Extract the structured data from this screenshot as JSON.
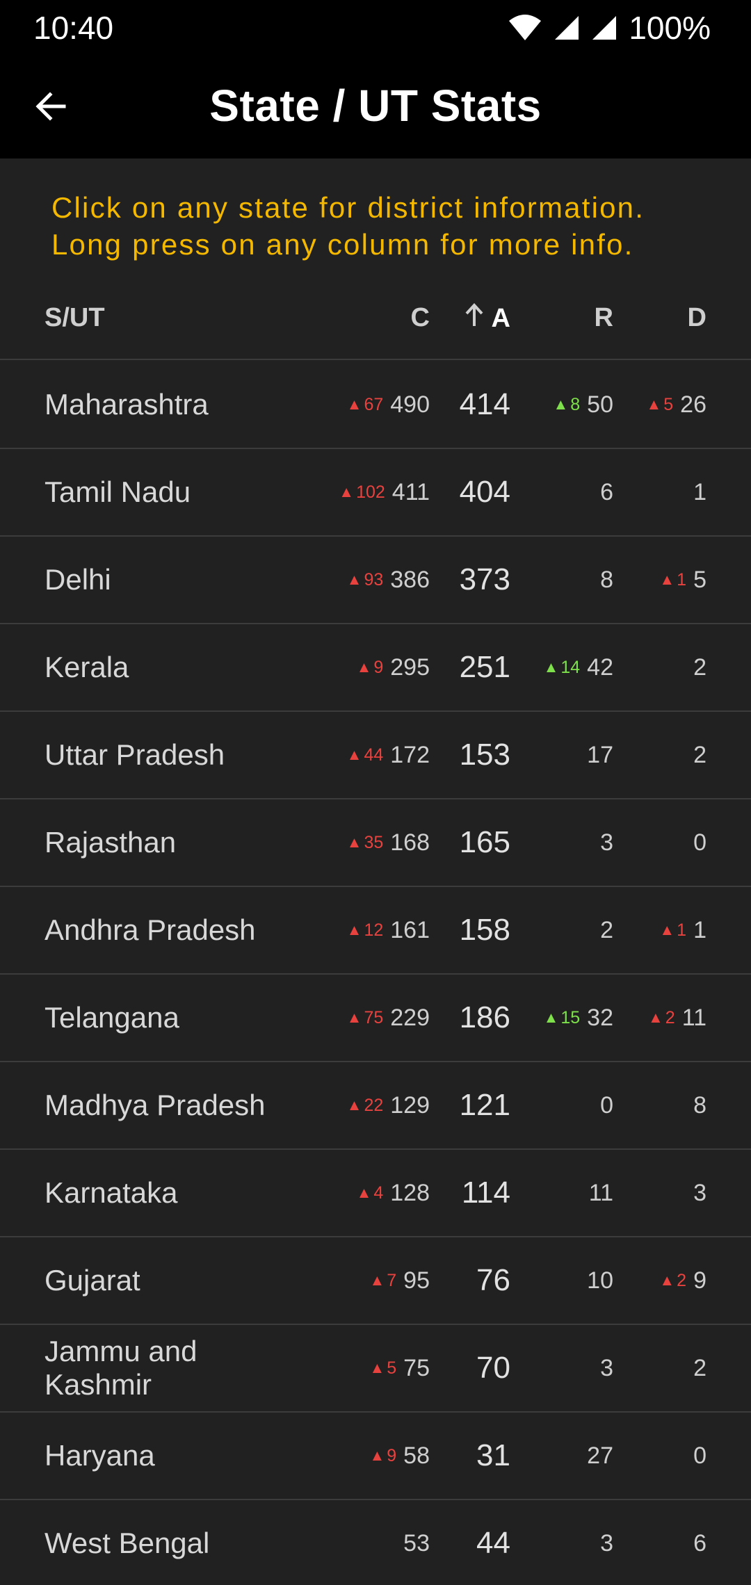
{
  "status_bar": {
    "time": "10:40",
    "battery": "100%"
  },
  "app_bar": {
    "title": "State / UT Stats"
  },
  "hint": {
    "line1": "Click on any state for district information.",
    "line2": "Long press on any column for more info."
  },
  "table": {
    "headers": {
      "state": "S/UT",
      "confirmed": "C",
      "active": "A",
      "recovered": "R",
      "deceased": "D"
    },
    "sort": {
      "column": "active",
      "direction": "up"
    },
    "rows": [
      {
        "name": "Maharashtra",
        "c_delta": "67",
        "c": "490",
        "a": "414",
        "r_delta": "8",
        "r": "50",
        "d_delta": "5",
        "d": "26"
      },
      {
        "name": "Tamil Nadu",
        "c_delta": "102",
        "c": "411",
        "a": "404",
        "r_delta": "",
        "r": "6",
        "d_delta": "",
        "d": "1"
      },
      {
        "name": "Delhi",
        "c_delta": "93",
        "c": "386",
        "a": "373",
        "r_delta": "",
        "r": "8",
        "d_delta": "1",
        "d": "5"
      },
      {
        "name": "Kerala",
        "c_delta": "9",
        "c": "295",
        "a": "251",
        "r_delta": "14",
        "r": "42",
        "d_delta": "",
        "d": "2"
      },
      {
        "name": "Uttar Pradesh",
        "c_delta": "44",
        "c": "172",
        "a": "153",
        "r_delta": "",
        "r": "17",
        "d_delta": "",
        "d": "2"
      },
      {
        "name": "Rajasthan",
        "c_delta": "35",
        "c": "168",
        "a": "165",
        "r_delta": "",
        "r": "3",
        "d_delta": "",
        "d": "0"
      },
      {
        "name": "Andhra Pradesh",
        "c_delta": "12",
        "c": "161",
        "a": "158",
        "r_delta": "",
        "r": "2",
        "d_delta": "1",
        "d": "1"
      },
      {
        "name": "Telangana",
        "c_delta": "75",
        "c": "229",
        "a": "186",
        "r_delta": "15",
        "r": "32",
        "d_delta": "2",
        "d": "11"
      },
      {
        "name": "Madhya Pradesh",
        "c_delta": "22",
        "c": "129",
        "a": "121",
        "r_delta": "",
        "r": "0",
        "d_delta": "",
        "d": "8"
      },
      {
        "name": "Karnataka",
        "c_delta": "4",
        "c": "128",
        "a": "114",
        "r_delta": "",
        "r": "11",
        "d_delta": "",
        "d": "3"
      },
      {
        "name": "Gujarat",
        "c_delta": "7",
        "c": "95",
        "a": "76",
        "r_delta": "",
        "r": "10",
        "d_delta": "2",
        "d": "9"
      },
      {
        "name": "Jammu and Kashmir",
        "c_delta": "5",
        "c": "75",
        "a": "70",
        "r_delta": "",
        "r": "3",
        "d_delta": "",
        "d": "2"
      },
      {
        "name": "Haryana",
        "c_delta": "9",
        "c": "58",
        "a": "31",
        "r_delta": "",
        "r": "27",
        "d_delta": "",
        "d": "0"
      },
      {
        "name": "West Bengal",
        "c_delta": "",
        "c": "53",
        "a": "44",
        "r_delta": "",
        "r": "3",
        "d_delta": "",
        "d": "6"
      }
    ]
  },
  "colors": {
    "hint": "#f5b800",
    "delta_red": "#e8423f",
    "delta_green": "#7ee04a",
    "background": "#212121",
    "bar": "#000000"
  }
}
